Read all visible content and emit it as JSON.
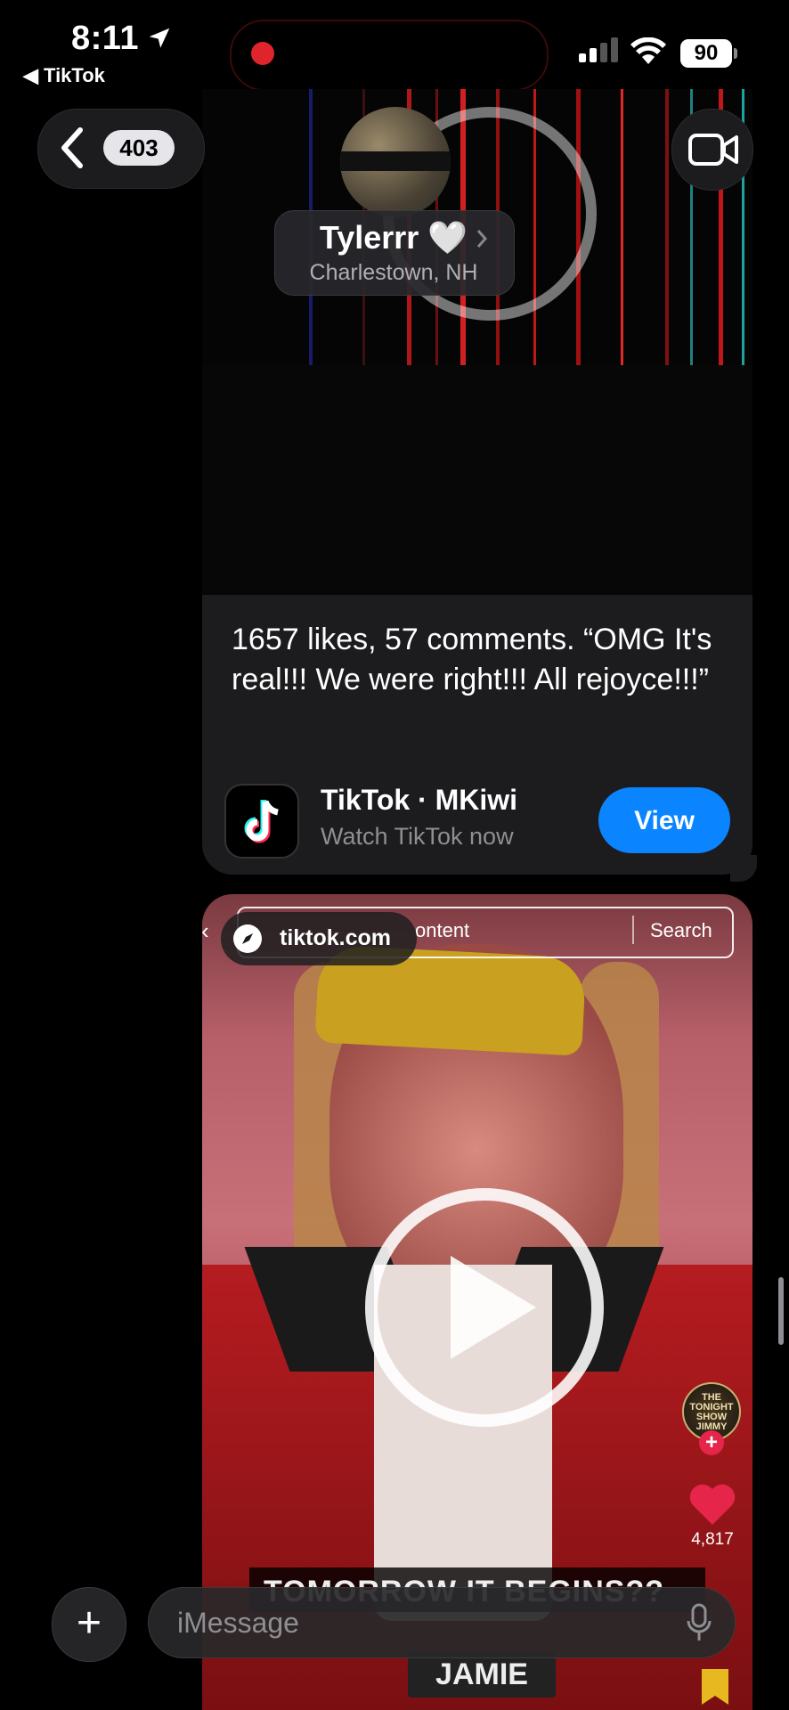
{
  "status_bar": {
    "time": "8:11",
    "back_app": "◀ TikTok",
    "battery": "90"
  },
  "header": {
    "unread_count": "403",
    "contact_name": "Tylerrr 🤍",
    "contact_location": "Charlestown, NH"
  },
  "messages": [
    {
      "type": "tiktok-link",
      "text": "1657 likes, 57 comments. “OMG It's real!!! We were right!!! All rejoyce!!!”",
      "link_title": "TikTok · MKiwi",
      "link_subtitle": "Watch TikTok now",
      "action_label": "View"
    },
    {
      "type": "video-preview",
      "site": "tiktok.com",
      "search_content": "ontent",
      "search_label": "Search",
      "show_badge": "THE TONIGHT SHOW JIMMY FALLON",
      "like_count": "4,817",
      "caption_top": "TOMORROW IT BEGINS??",
      "caption_bottom": "JAMIE"
    }
  ],
  "composer": {
    "placeholder": "iMessage"
  },
  "colors": {
    "accent": "#0a84ff",
    "bubble": "#1c1c1e",
    "recording": "#e0242b"
  }
}
